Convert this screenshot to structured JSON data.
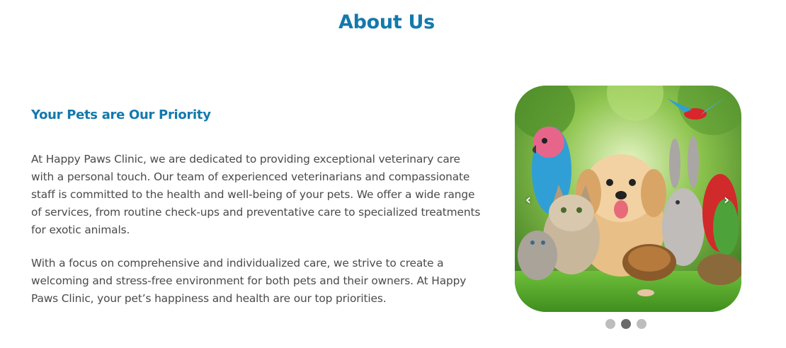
{
  "page": {
    "title": "About Us"
  },
  "about": {
    "heading": "Your Pets are Our Priority",
    "paragraphs": [
      "At Happy Paws Clinic, we are dedicated to providing exceptional veterinary care with a personal touch. Our team of experienced veterinarians and compassionate staff is committed to the health and well-being of your pets. We offer a wide range of services, from routine check-ups and preventative care to specialized treatments for exotic animals.",
      "With a focus on comprehensive and individualized care, we strive to create a welcoming and stress-free environment for both pets and their owners. At Happy Paws Clinic, your pet’s happiness and health are our top priorities."
    ]
  },
  "carousel": {
    "prev_icon": "‹",
    "next_icon": "›",
    "active_index": 1,
    "slide_count": 3
  },
  "colors": {
    "brand_blue": "#1379ad",
    "body_text": "#4a4a4a",
    "dot_inactive": "#bdbdbd",
    "dot_active": "#6b6b6b"
  },
  "icons": {
    "prev": "chevron-left-icon",
    "next": "chevron-right-icon"
  }
}
